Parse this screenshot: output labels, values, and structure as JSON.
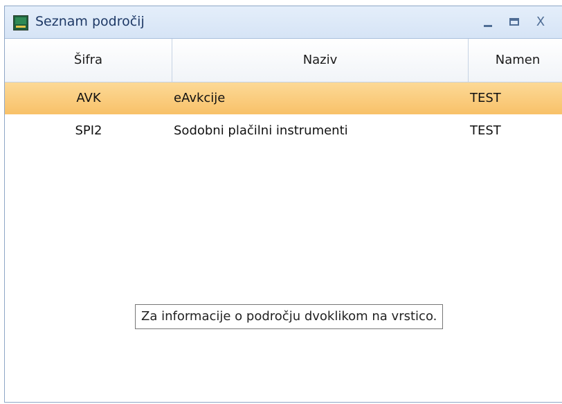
{
  "window": {
    "title": "Seznam področij",
    "minimize_glyph": "_",
    "close_glyph": "X"
  },
  "icons": {
    "app": "app-icon",
    "minimize": "minimize-icon",
    "maximize": "maximize-icon",
    "close": "close-icon"
  },
  "table": {
    "columns": [
      "Šifra",
      "Naziv",
      "Namen"
    ],
    "rows": [
      {
        "sifra": "AVK",
        "naziv": "eAvkcije",
        "namen": "TEST",
        "selected": true
      },
      {
        "sifra": "SPI2",
        "naziv": "Sodobni plačilni instrumenti",
        "namen": "TEST",
        "selected": false
      }
    ]
  },
  "tooltip": {
    "text": "Za informacije o področju dvoklikom na vrstico."
  },
  "colors": {
    "selection": "#f8c169",
    "titlebar": "#d6e4f6",
    "title_text": "#1e3966"
  }
}
